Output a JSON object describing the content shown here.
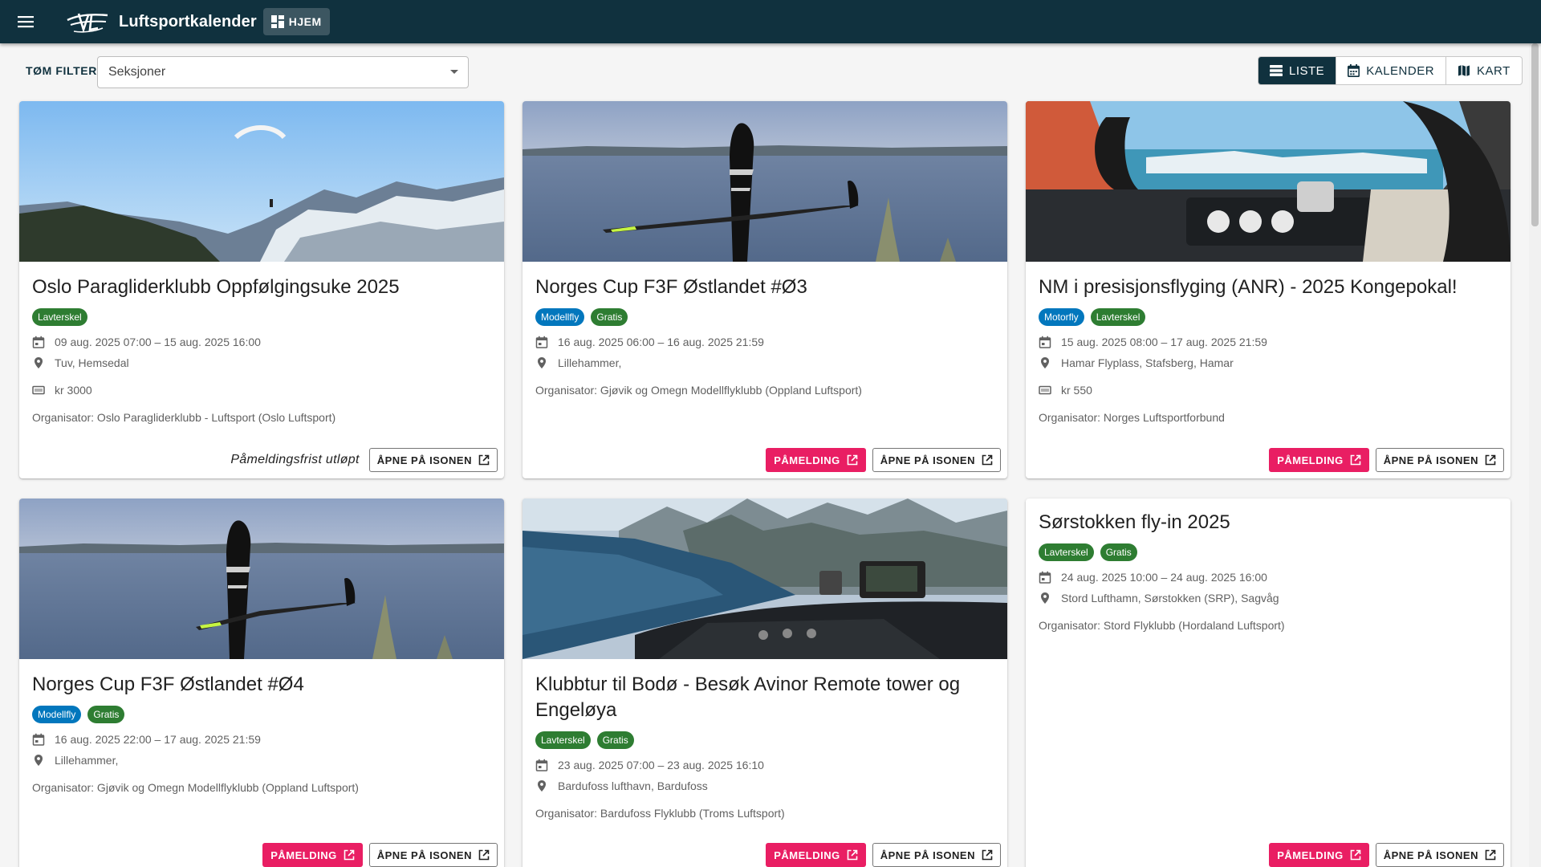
{
  "appbar": {
    "title": "Luftsportkalender",
    "home_label": "HJEM"
  },
  "filter": {
    "clear_label": "TØM FILTER",
    "sections_placeholder": "Seksjoner"
  },
  "views": [
    {
      "label": "LISTE",
      "icon": "list-icon",
      "active": true
    },
    {
      "label": "KALENDER",
      "icon": "calendar-icon",
      "active": false
    },
    {
      "label": "KART",
      "icon": "map-icon",
      "active": false
    }
  ],
  "colors": {
    "appbar": "#10313e",
    "registration": "#e91e63",
    "tag_green": "#2e7d32",
    "tag_blue": "#0277bd"
  },
  "cards": [
    {
      "title": "Oslo Paragliderklubb Oppfølgingsuke 2025",
      "image": "paraglider-over-fjord",
      "tags": [
        {
          "label": "Lavterskel",
          "color": "#2e7d32"
        }
      ],
      "date": "09 aug. 2025 07:00 – 15 aug. 2025 16:00",
      "location": "Tuv, Hemsedal",
      "price": "kr 3000",
      "organizer": "Organisator: Oslo Paragliderklubb - Luftsport (Oslo Luftsport)",
      "deadline": "Påmeldingsfrist utløpt",
      "register_label": "",
      "open_label": "ÅPNE PÅ ISONEN"
    },
    {
      "title": "Norges Cup F3F Østlandet #Ø3",
      "image": "model-glider-over-lake",
      "tags": [
        {
          "label": "Modellfly",
          "color": "#0277bd"
        },
        {
          "label": "Gratis",
          "color": "#2e7d32"
        }
      ],
      "date": "16 aug. 2025 06:00 – 16 aug. 2025 21:59",
      "location": "Lillehammer,",
      "price": "",
      "organizer": "Organisator: Gjøvik og Omegn Modellflyklubb (Oppland Luftsport)",
      "deadline": "",
      "register_label": "PÅMELDING",
      "open_label": "ÅPNE PÅ ISONEN"
    },
    {
      "title": "NM i presisjonsflyging (ANR) - 2025 Kongepokal!",
      "image": "cockpit-pilots",
      "tags": [
        {
          "label": "Motorfly",
          "color": "#0277bd"
        },
        {
          "label": "Lavterskel",
          "color": "#2e7d32"
        }
      ],
      "date": "15 aug. 2025 08:00 – 17 aug. 2025 21:59",
      "location": "Hamar Flyplass, Stafsberg, Hamar",
      "price": "kr 550",
      "organizer": "Organisator: Norges Luftsportforbund",
      "deadline": "",
      "register_label": "PÅMELDING",
      "open_label": "ÅPNE PÅ ISONEN"
    },
    {
      "title": "Norges Cup F3F Østlandet #Ø4",
      "image": "model-glider-over-lake",
      "tags": [
        {
          "label": "Modellfly",
          "color": "#0277bd"
        },
        {
          "label": "Gratis",
          "color": "#2e7d32"
        }
      ],
      "date": "16 aug. 2025 22:00 – 17 aug. 2025 21:59",
      "location": "Lillehammer,",
      "price": "",
      "organizer": "Organisator: Gjøvik og Omegn Modellflyklubb (Oppland Luftsport)",
      "deadline": "",
      "register_label": "PÅMELDING",
      "open_label": "ÅPNE PÅ ISONEN"
    },
    {
      "title": "Klubbtur til Bodø - Besøk Avinor Remote tower og Engeløya",
      "image": "cockpit-over-mountains",
      "tags": [
        {
          "label": "Lavterskel",
          "color": "#2e7d32"
        },
        {
          "label": "Gratis",
          "color": "#2e7d32"
        }
      ],
      "date": "23 aug. 2025 07:00 – 23 aug. 2025 16:10",
      "location": "Bardufoss lufthavn, Bardufoss",
      "price": "",
      "organizer": "Organisator: Bardufoss Flyklubb (Troms Luftsport)",
      "deadline": "",
      "register_label": "PÅMELDING",
      "open_label": "ÅPNE PÅ ISONEN"
    },
    {
      "title": "Sørstokken fly-in 2025",
      "image": "",
      "tags": [
        {
          "label": "Lavterskel",
          "color": "#2e7d32"
        },
        {
          "label": "Gratis",
          "color": "#2e7d32"
        }
      ],
      "date": "24 aug. 2025 10:00 – 24 aug. 2025 16:00",
      "location": "Stord Lufthamn, Sørstokken (SRP), Sagvåg",
      "price": "",
      "organizer": "Organisator: Stord Flyklubb (Hordaland Luftsport)",
      "deadline": "",
      "register_label": "PÅMELDING",
      "open_label": "ÅPNE PÅ ISONEN"
    }
  ]
}
